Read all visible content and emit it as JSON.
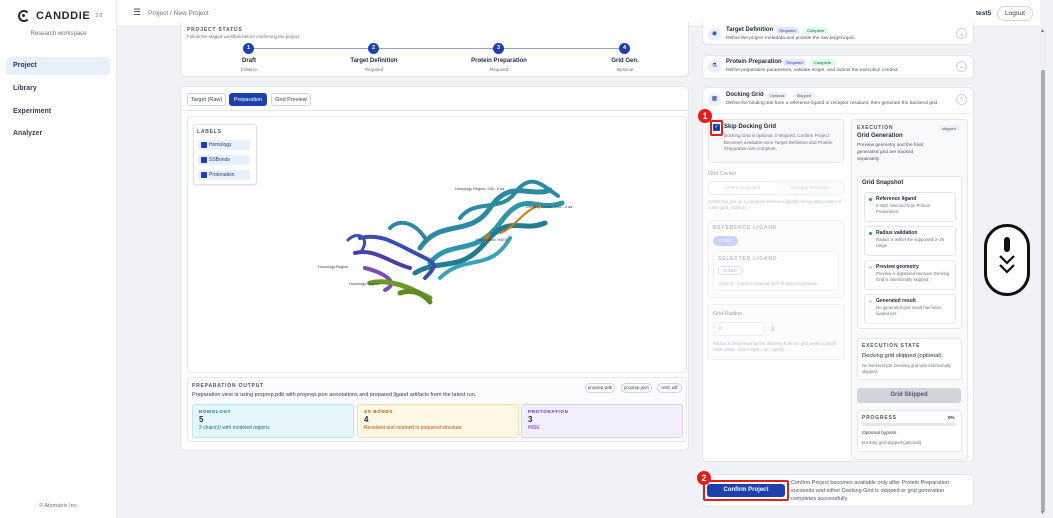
{
  "app": {
    "brand": "CANDDIE",
    "version": "2.0",
    "tagline": "Research workspace",
    "copyright": "© Atomatrix Inc."
  },
  "nav": [
    {
      "label": "Project"
    },
    {
      "label": "Library"
    },
    {
      "label": "Experiment"
    },
    {
      "label": "Analyzer"
    }
  ],
  "header": {
    "breadcrumb": "Project / New Project",
    "user": "test5",
    "logout": "Logout"
  },
  "status": {
    "title": "PROJECT STATUS",
    "subtitle": "Follow the staged workflow before confirming the project.",
    "steps": [
      {
        "num": "1",
        "name": "Draft",
        "sub": "Initialize"
      },
      {
        "num": "2",
        "name": "Target Definition",
        "sub": "Required"
      },
      {
        "num": "3",
        "name": "Protein Preparation",
        "sub": "Required"
      },
      {
        "num": "4",
        "name": "Grid Gen.",
        "sub": "Optional"
      }
    ]
  },
  "tabs": [
    {
      "label": "Target (Raw)"
    },
    {
      "label": "Preparation"
    },
    {
      "label": "Grid Preview"
    }
  ],
  "labels_panel": {
    "title": "LABELS",
    "items": [
      "Homology",
      "SSBonds",
      "Protonation"
    ]
  },
  "viewer": {
    "annotations": [
      "Homology Region: 238 - 8 aa",
      "Docking Center: IMG - 4 aa",
      "Protonation: H2E0",
      "Homology Region",
      "Homology Region"
    ],
    "colors": {
      "teal": "#2b8aa0",
      "blue": "#3b4cb0",
      "green": "#6a9a2a",
      "purple": "#7a4fb5",
      "orange": "#d97706"
    }
  },
  "prep_output": {
    "title": "PREPARATION OUTPUT",
    "desc": "Preparation view is using proprep.pdb with proprep.json annotations and prepared ligand artifacts from the latest run.",
    "files": [
      "proprep.pdb",
      "proprep.json",
      "V6G.sdf"
    ],
    "stats": [
      {
        "title": "HOMOLOGY",
        "value": "5",
        "desc": "2 chain(s) with modeled regions"
      },
      {
        "title": "SS BONDS",
        "value": "4",
        "desc": "Resolved and retained in prepared structure"
      },
      {
        "title": "PROTONATION",
        "value": "3",
        "desc": "HISE"
      }
    ]
  },
  "panels": {
    "target": {
      "title": "Target Definition",
      "badges": [
        "Required",
        "Complete"
      ],
      "desc": "Define the project metadata and provide the raw target input."
    },
    "protein": {
      "title": "Protein Preparation",
      "badges": [
        "Required",
        "Complete"
      ],
      "desc": "Define preparation parameters, validate scope, and submit the execution context."
    },
    "docking": {
      "title": "Docking Grid",
      "badges": [
        "Optional",
        "Skipped"
      ],
      "desc": "Define the binding site from a reference ligand or receptor residues, then generate the backend grid."
    }
  },
  "docking": {
    "skip_label": "Skip Docking Grid",
    "skip_desc": "Docking Grid is optional. If skipped, Confirm Project becomes available once Target Definition and Protein Preparation are complete.",
    "grid_center": "Grid Center",
    "center_opts": [
      "Reference Ligand",
      "Receptor Residues"
    ],
    "center_note": "Center the grid on a prepared reference ligand's heavy-atom center of mass (grid_mode 1).",
    "ref_ligand_title": "REFERENCE LIGAND",
    "ref_ligand_chip": "II-V6G",
    "selected_title": "SELECTED LIGAND",
    "selected_chip": "II-V6G",
    "selected_desc": "Chain R · 1 atoms retained from Protein Preparation.",
    "grid_radius": "Grid Radius",
    "radius_value": "8",
    "radius_unit": "Å",
    "radius_note": "Radius is interpreted as the distance from the grid center to each cube vertex. Side length = 2r / sqrt(3)."
  },
  "execution": {
    "title": "EXECUTION",
    "badge": "skipped",
    "subtitle": "Grid Generation",
    "desc": "Preview geometry and the final generated grid are tracked separately.",
    "snapshot_title": "Grid Snapshot",
    "snapshot": [
      {
        "title": "Reference ligand",
        "desc": "II-V6G selected from Protein Preparation.",
        "color": "#16a34a"
      },
      {
        "title": "Radius validation",
        "desc": "Radius is within the supported 3–25 range.",
        "color": "#16a34a"
      },
      {
        "title": "Preview geometry",
        "desc": "Preview is bypassed because Docking Grid is intentionally skipped.",
        "color": "#cbd5e1"
      },
      {
        "title": "Generated result",
        "desc": "No generated grid result has been loaded yet.",
        "color": "#cbd5e1"
      }
    ],
    "state_title": "EXECUTION STATE",
    "state_value": "Docking grid skipped (optional).",
    "state_desc": "No backend job. Docking grid was intentionally skipped.",
    "button": "Grid Skipped",
    "progress_title": "PROGRESS",
    "progress_pct": "0%",
    "progress_value": 0,
    "progress_line1": "Optional bypass",
    "progress_line2": "Docking grid skipped (optional)."
  },
  "confirm": {
    "button": "Confirm Project",
    "desc": "Confirm Project becomes available only after Protein Preparation succeeds and either Docking Grid is skipped or grid generation completes successfully."
  },
  "markers": [
    "1",
    "2"
  ]
}
